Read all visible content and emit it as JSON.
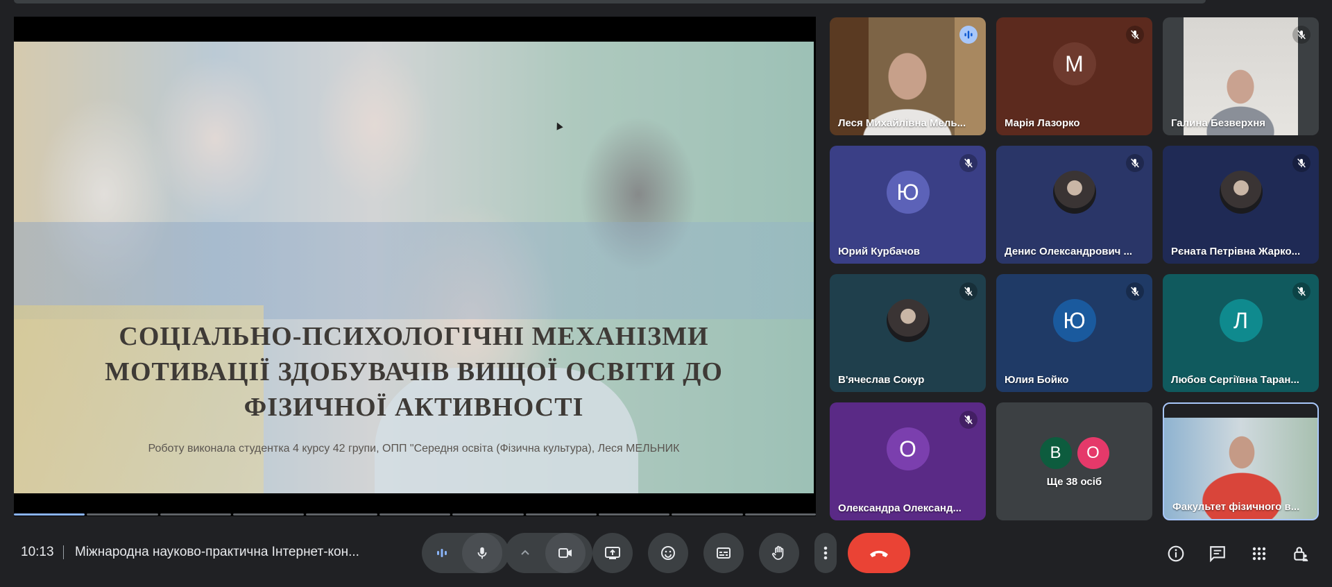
{
  "presentation": {
    "title": "СОЦІАЛЬНО-ПСИХОЛОГІЧНІ МЕХАНІЗМИ МОТИВАЦІЇ ЗДОБУВАЧІВ ВИЩОЇ ОСВІТИ ДО ФІЗИЧНОЇ АКТИВНОСТІ",
    "title_lines": [
      "СОЦІАЛЬНО-ПСИХОЛОГІЧНІ МЕХАНІЗМИ",
      "МОТИВАЦІЇ ЗДОБУВАЧІВ ВИЩОЇ ОСВІТИ ДО",
      "ФІЗИЧНОЇ АКТИВНОСТІ"
    ],
    "subtitle": "Роботу виконала студентка 4 курсу 42 групи, ОПП \"Середня освіта (Фізична культура), Леся МЕЛЬНИК",
    "progress_segments": 11,
    "progress_done": 1
  },
  "participants": [
    {
      "name": "Леся Михайлівна Мель...",
      "type": "video",
      "mic": "speaking"
    },
    {
      "name": "Марія Лазорко",
      "type": "avatar",
      "initial": "М",
      "mic": "muted",
      "bg": "#5c2a1e",
      "avatar_bg": "#6e3a2e"
    },
    {
      "name": "Галина Безверхня",
      "type": "video",
      "mic": "muted"
    },
    {
      "name": "Юрий Курбачов",
      "type": "avatar",
      "initial": "Ю",
      "mic": "muted",
      "bg": "#3a3f86",
      "avatar_bg": "#5c62b8"
    },
    {
      "name": "Денис Олександрович ...",
      "type": "photo",
      "mic": "muted",
      "bg": "#2a3668"
    },
    {
      "name": "Рєната Петрівна Жарко...",
      "type": "photo",
      "mic": "muted",
      "bg": "#1f2a55"
    },
    {
      "name": "В'ячеслав Сокур",
      "type": "photo",
      "mic": "muted",
      "bg": "#1f3f4c"
    },
    {
      "name": "Юлия Бойко",
      "type": "avatar",
      "initial": "Ю",
      "mic": "muted",
      "bg": "#1f3a66",
      "avatar_bg": "#1a5a9e"
    },
    {
      "name": "Любов Сергіївна Таран...",
      "type": "avatar",
      "initial": "Л",
      "mic": "muted",
      "bg": "#105a5e",
      "avatar_bg": "#0f8a8e"
    },
    {
      "name": "Олександра Олександ...",
      "type": "avatar",
      "initial": "О",
      "mic": "muted",
      "bg": "#5a2a86",
      "avatar_bg": "#7b3fae"
    },
    {
      "name": "Ще 38 осіб",
      "type": "more",
      "initials": [
        "В",
        "О"
      ]
    },
    {
      "name": "Факультет фізичного в...",
      "type": "video",
      "mic": "none"
    }
  ],
  "bottom": {
    "time": "10:13",
    "meeting_title": "Міжнародна науково-практична Інтернет-кон..."
  },
  "colors": {
    "end_call": "#ea4335",
    "tile_bg": "#3c4043",
    "selected_border": "#a8c7fa"
  }
}
